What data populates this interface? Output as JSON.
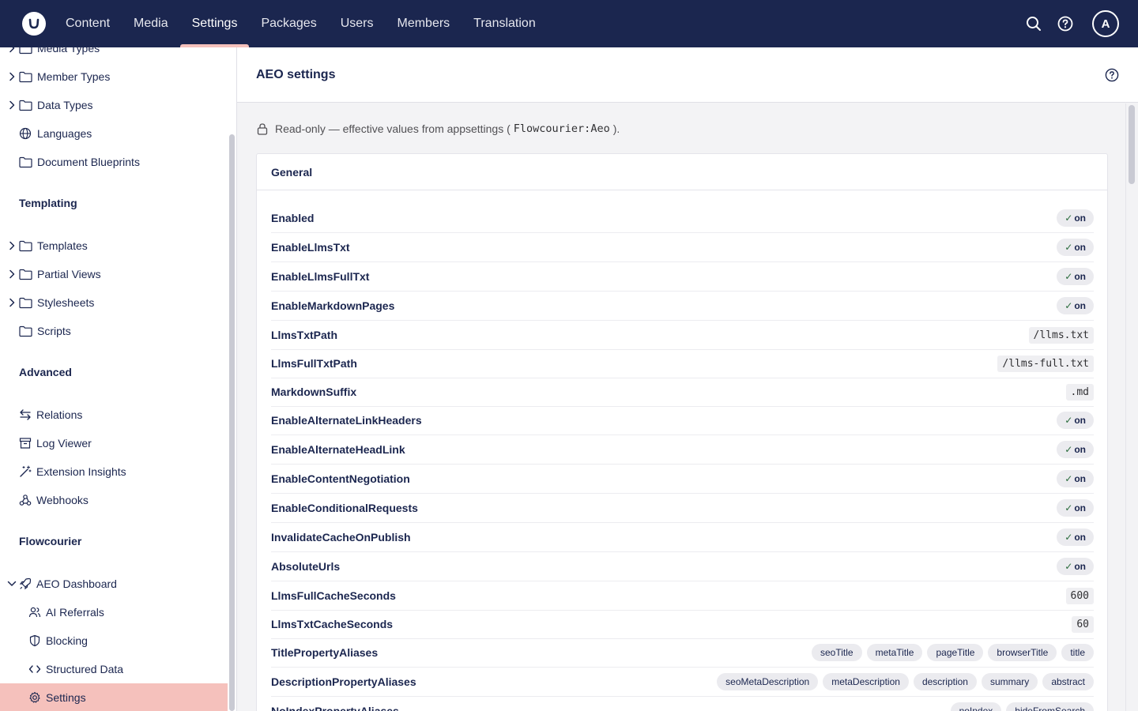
{
  "topnav": {
    "items": [
      "Content",
      "Media",
      "Settings",
      "Packages",
      "Users",
      "Members",
      "Translation"
    ],
    "active": "Settings",
    "avatar_initial": "A"
  },
  "sidebar": {
    "items_top": [
      {
        "label": "Media Types",
        "chevron": true,
        "icon": "folder-icon"
      },
      {
        "label": "Member Types",
        "chevron": true,
        "icon": "folder-icon"
      },
      {
        "label": "Data Types",
        "chevron": true,
        "icon": "folder-icon"
      },
      {
        "label": "Languages",
        "chevron": false,
        "icon": "globe-icon"
      },
      {
        "label": "Document Blueprints",
        "chevron": false,
        "icon": "folder-icon"
      }
    ],
    "templating_heading": "Templating",
    "templating_items": [
      {
        "label": "Templates",
        "chevron": true,
        "icon": "folder-icon"
      },
      {
        "label": "Partial Views",
        "chevron": true,
        "icon": "folder-icon"
      },
      {
        "label": "Stylesheets",
        "chevron": true,
        "icon": "folder-icon"
      },
      {
        "label": "Scripts",
        "chevron": false,
        "icon": "folder-icon"
      }
    ],
    "advanced_heading": "Advanced",
    "advanced_items": [
      {
        "label": "Relations",
        "icon": "arrows-icon"
      },
      {
        "label": "Log Viewer",
        "icon": "archive-icon"
      },
      {
        "label": "Extension Insights",
        "icon": "wand-icon"
      },
      {
        "label": "Webhooks",
        "icon": "webhook-icon"
      }
    ],
    "flowcourier_heading": "Flowcourier",
    "flowcourier_root": {
      "label": "AEO Dashboard",
      "icon": "rocket-icon"
    },
    "flowcourier_children": [
      {
        "label": "AI Referrals",
        "icon": "users-icon"
      },
      {
        "label": "Blocking",
        "icon": "shield-icon"
      },
      {
        "label": "Structured Data",
        "icon": "code-icon"
      },
      {
        "label": "Settings",
        "icon": "gear-icon",
        "active": true
      }
    ]
  },
  "main": {
    "title": "AEO settings",
    "readonly_prefix": "Read-only — effective values from appsettings (",
    "readonly_code": "Flowcourier:Aeo",
    "readonly_suffix": ").",
    "section_title": "General",
    "on_label": "on",
    "on_check": "✓",
    "rows": [
      {
        "key": "Enabled",
        "type": "on"
      },
      {
        "key": "EnableLlmsTxt",
        "type": "on"
      },
      {
        "key": "EnableLlmsFullTxt",
        "type": "on"
      },
      {
        "key": "EnableMarkdownPages",
        "type": "on"
      },
      {
        "key": "LlmsTxtPath",
        "type": "mono",
        "value": "/llms.txt"
      },
      {
        "key": "LlmsFullTxtPath",
        "type": "mono",
        "value": "/llms-full.txt"
      },
      {
        "key": "MarkdownSuffix",
        "type": "mono",
        "value": ".md"
      },
      {
        "key": "EnableAlternateLinkHeaders",
        "type": "on"
      },
      {
        "key": "EnableAlternateHeadLink",
        "type": "on"
      },
      {
        "key": "EnableContentNegotiation",
        "type": "on"
      },
      {
        "key": "EnableConditionalRequests",
        "type": "on"
      },
      {
        "key": "InvalidateCacheOnPublish",
        "type": "on"
      },
      {
        "key": "AbsoluteUrls",
        "type": "on"
      },
      {
        "key": "LlmsFullCacheSeconds",
        "type": "mono",
        "value": "600"
      },
      {
        "key": "LlmsTxtCacheSeconds",
        "type": "mono",
        "value": "60"
      },
      {
        "key": "TitlePropertyAliases",
        "type": "tags",
        "values": [
          "seoTitle",
          "metaTitle",
          "pageTitle",
          "browserTitle",
          "title"
        ]
      },
      {
        "key": "DescriptionPropertyAliases",
        "type": "tags",
        "values": [
          "seoMetaDescription",
          "metaDescription",
          "description",
          "summary",
          "abstract"
        ]
      },
      {
        "key": "NoIndexPropertyAliases",
        "type": "tags",
        "values": [
          "noIndex",
          "hideFromSearch"
        ]
      }
    ]
  }
}
